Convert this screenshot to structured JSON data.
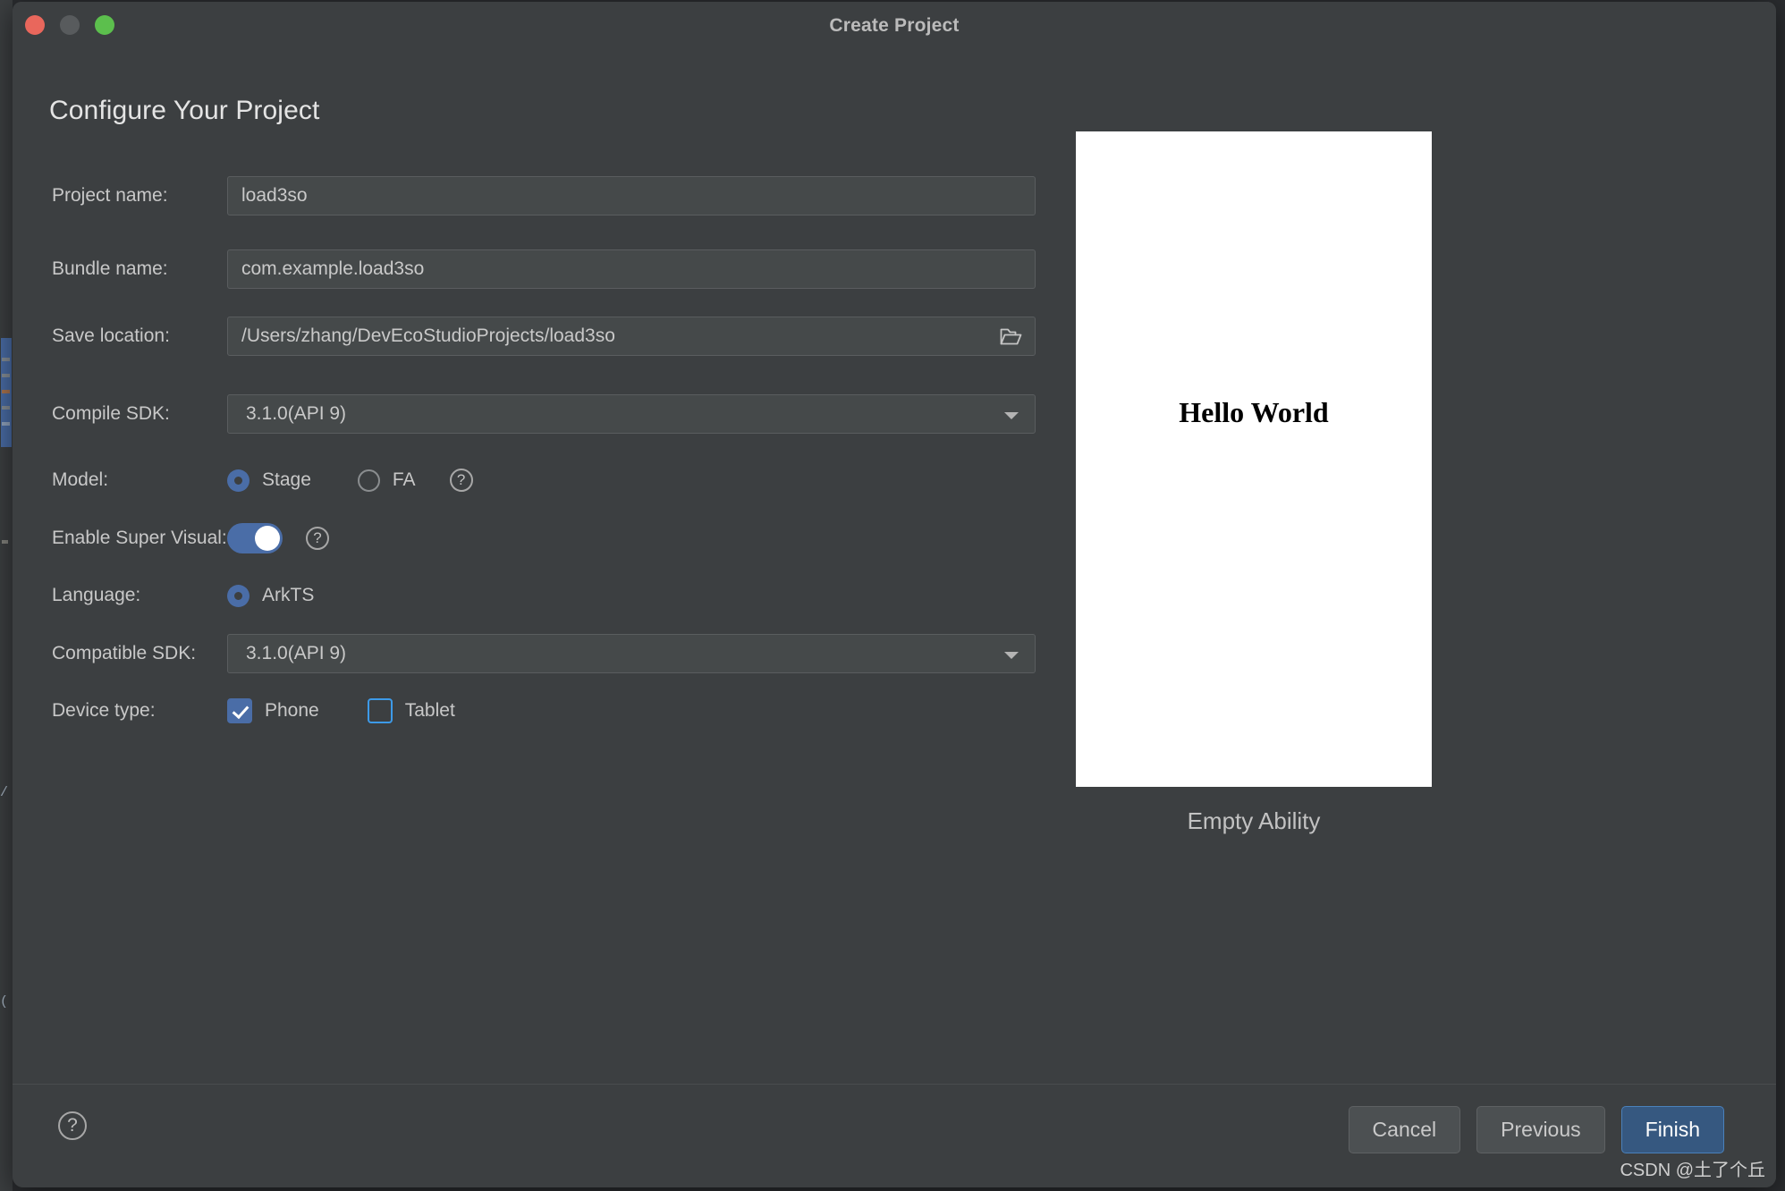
{
  "window": {
    "title": "Create Project",
    "traffic_lights": [
      "close",
      "minimize",
      "zoom"
    ]
  },
  "heading": "Configure Your Project",
  "form": {
    "fields": [
      {
        "label": "Project name:",
        "value": "load3so",
        "type": "text"
      },
      {
        "label": "Bundle name:",
        "value": "com.example.load3so",
        "type": "text"
      },
      {
        "label": "Save location:",
        "value": "/Users/zhang/DevEcoStudioProjects/load3so",
        "type": "path",
        "icon": "folder-open-icon"
      },
      {
        "label": "Compile SDK:",
        "value": "3.1.0(API 9)",
        "type": "select",
        "icon": "chevron-down-icon"
      }
    ],
    "model": {
      "label": "Model:",
      "options": [
        {
          "label": "Stage",
          "selected": true
        },
        {
          "label": "FA",
          "selected": false
        }
      ],
      "help": "?"
    },
    "super_visual": {
      "label": "Enable Super Visual:",
      "enabled": true,
      "help": "?"
    },
    "language": {
      "label": "Language:",
      "options": [
        {
          "label": "ArkTS",
          "selected": true
        }
      ]
    },
    "compatible_sdk": {
      "label": "Compatible SDK:",
      "value": "3.1.0(API 9)",
      "icon": "chevron-down-icon"
    },
    "device_type": {
      "label": "Device type:",
      "options": [
        {
          "label": "Phone",
          "checked": true
        },
        {
          "label": "Tablet",
          "checked": false
        }
      ]
    }
  },
  "preview": {
    "screen_text": "Hello World",
    "caption": "Empty Ability"
  },
  "footer": {
    "help": "?",
    "cancel_label": "Cancel",
    "previous_label": "Previous",
    "finish_label": "Finish"
  },
  "watermark": "CSDN @土了个丘",
  "colors": {
    "dialog_bg": "#3c3f41",
    "field_bg": "#45494a",
    "accent_blue": "#4a6da7",
    "primary_button": "#365880",
    "checkbox_outline": "#3d9ae8",
    "traffic_close": "#e9675c",
    "traffic_min": "#585b5d",
    "traffic_zoom": "#5cbf4d"
  }
}
